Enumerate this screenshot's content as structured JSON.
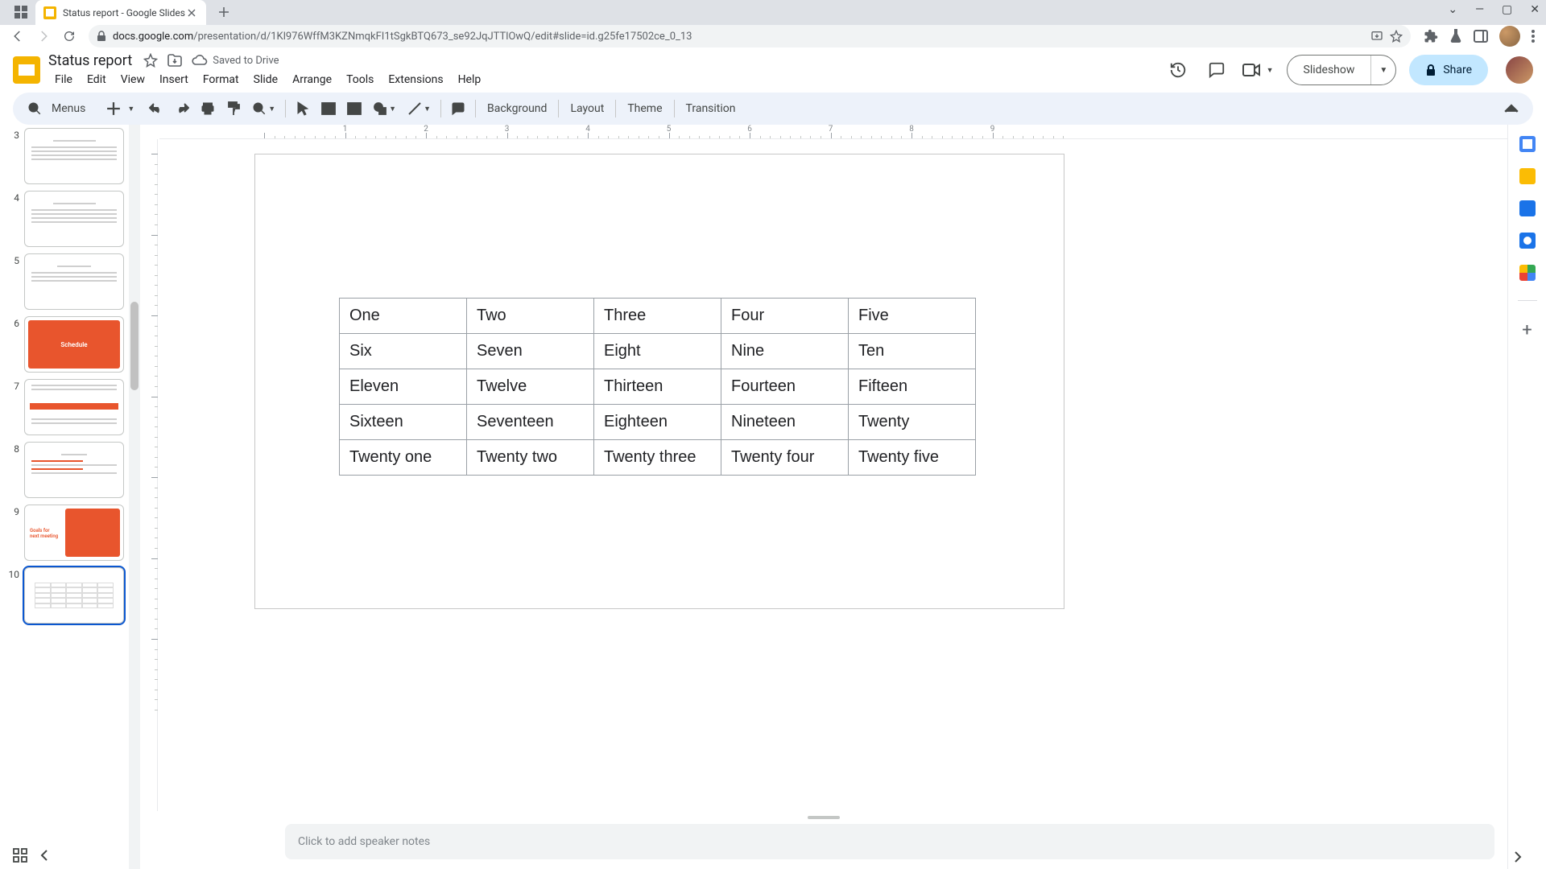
{
  "browser": {
    "tab_title": "Status report - Google Slides",
    "url_host": "docs.google.com",
    "url_path": "/presentation/d/1Kl976WffM3KZNmqkFI1tSgkBTQ673_se92JqJTTlOwQ/edit#slide=id.g25fe17502ce_0_13"
  },
  "doc": {
    "title": "Status report",
    "drive_status": "Saved to Drive"
  },
  "menubar": [
    "File",
    "Edit",
    "View",
    "Insert",
    "Format",
    "Slide",
    "Arrange",
    "Tools",
    "Extensions",
    "Help"
  ],
  "header_buttons": {
    "slideshow": "Slideshow",
    "share": "Share"
  },
  "toolbar": {
    "menus_label": "Menus",
    "background": "Background",
    "layout": "Layout",
    "theme": "Theme",
    "transition": "Transition"
  },
  "thumbnails": [
    {
      "num": "3",
      "type": "text"
    },
    {
      "num": "4",
      "type": "text"
    },
    {
      "num": "5",
      "type": "text"
    },
    {
      "num": "6",
      "type": "accent",
      "label": "Schedule"
    },
    {
      "num": "7",
      "type": "timeline"
    },
    {
      "num": "8",
      "type": "text"
    },
    {
      "num": "9",
      "type": "half-accent",
      "label": "Goals for next meeting"
    },
    {
      "num": "10",
      "type": "table",
      "selected": true
    }
  ],
  "ruler_labels": [
    "1",
    "2",
    "3",
    "4",
    "5",
    "6",
    "7",
    "8",
    "9"
  ],
  "notes_placeholder": "Click to add speaker notes",
  "chart_data": {
    "type": "table",
    "rows": [
      [
        "One",
        "Two",
        "Three",
        "Four",
        "Five"
      ],
      [
        "Six",
        "Seven",
        "Eight",
        "Nine",
        "Ten"
      ],
      [
        "Eleven",
        "Twelve",
        "Thirteen",
        "Fourteen",
        "Fifteen"
      ],
      [
        "Sixteen",
        "Seventeen",
        "Eighteen",
        "Nineteen",
        "Twenty"
      ],
      [
        "Twenty one",
        "Twenty two",
        "Twenty three",
        "Twenty four",
        "Twenty five"
      ]
    ]
  }
}
